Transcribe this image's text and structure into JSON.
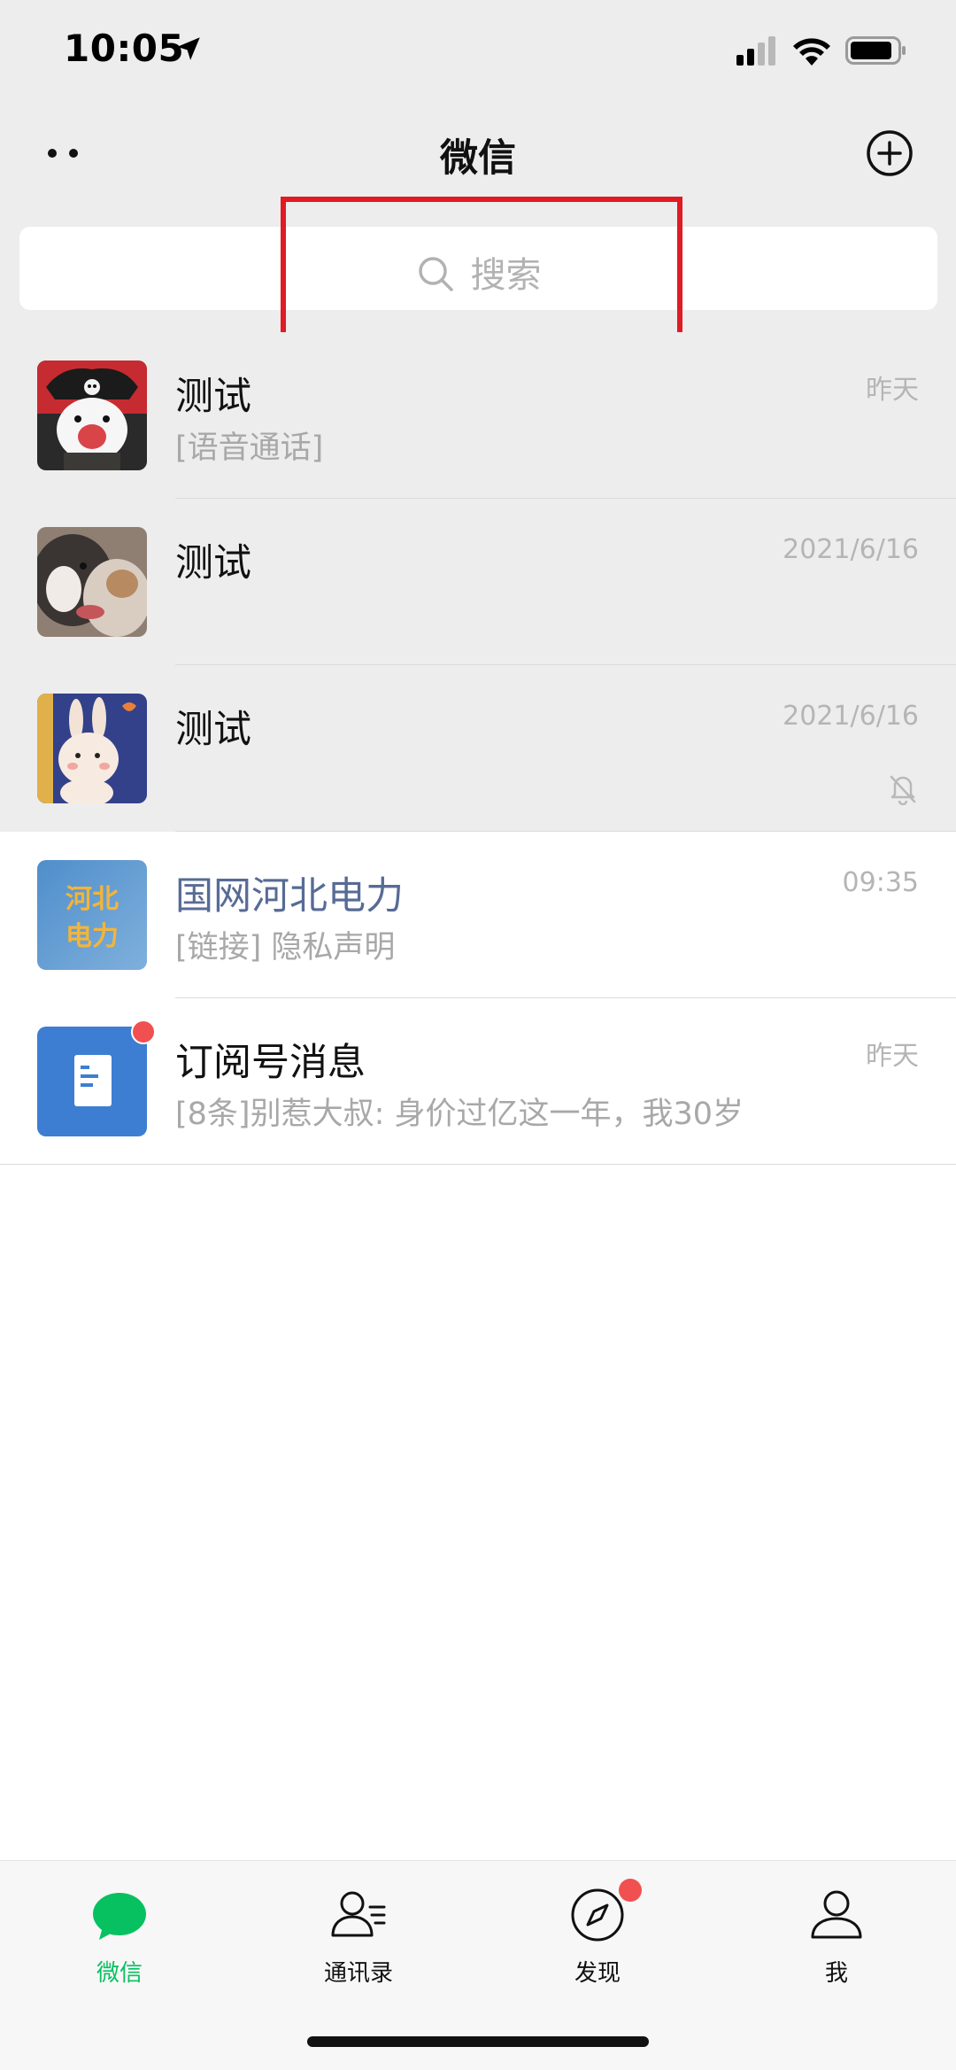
{
  "status_bar": {
    "time": "10:05"
  },
  "nav": {
    "title": "微信"
  },
  "search": {
    "placeholder": "搜索"
  },
  "chats": [
    {
      "name": "测试",
      "preview": "[语音通话]",
      "time": "昨天",
      "pinned": true,
      "muted": false,
      "avatar": "cartoon-character-avatar"
    },
    {
      "name": "测试",
      "preview": "",
      "time": "2021/6/16",
      "pinned": true,
      "muted": false,
      "avatar": "dogs-photo-avatar"
    },
    {
      "name": "测试",
      "preview": "",
      "time": "2021/6/16",
      "pinned": true,
      "muted": true,
      "avatar": "bunny-illustration-avatar"
    },
    {
      "name": "国网河北电力",
      "preview": "[链接] 隐私声明",
      "time": "09:35",
      "pinned": false,
      "muted": false,
      "avatar": "hebei-power-logo",
      "avatar_text": "河北电力"
    },
    {
      "name": "订阅号消息",
      "preview": "[8条]别惹大叔: 身价过亿这一年，我30岁",
      "time": "昨天",
      "pinned": false,
      "muted": false,
      "avatar": "subscription-document-icon",
      "unread_dot": true
    }
  ],
  "tabs": [
    {
      "label": "微信",
      "icon": "chat-bubble-icon",
      "active": true
    },
    {
      "label": "通讯录",
      "icon": "contacts-icon",
      "active": false
    },
    {
      "label": "发现",
      "icon": "compass-icon",
      "active": false,
      "badge_dot": true
    },
    {
      "label": "我",
      "icon": "person-icon",
      "active": false
    }
  ],
  "colors": {
    "accent": "#07c160",
    "header_bg": "#ededed",
    "badge": "#f15050",
    "highlight_box": "#e01b24",
    "official_name": "#576b95"
  }
}
